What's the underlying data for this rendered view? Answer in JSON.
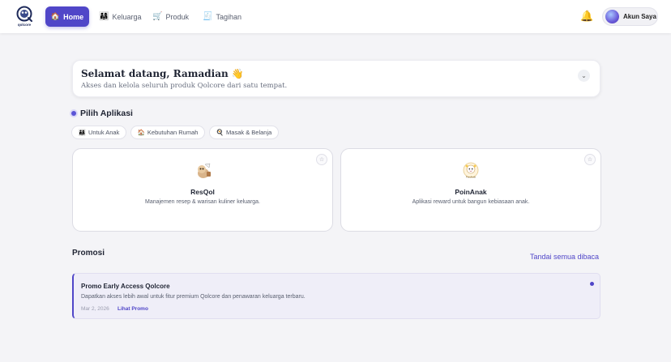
{
  "nav": {
    "logo_text": "qolcore",
    "items": [
      {
        "label": "Home",
        "icon": "house-icon",
        "glyph": "🏠",
        "active": true
      },
      {
        "label": "Keluarga",
        "icon": "family-icon",
        "glyph": "👨‍👩‍👧"
      },
      {
        "label": "Produk",
        "icon": "cart-icon",
        "glyph": "🛒"
      },
      {
        "label": "Tagihan",
        "icon": "receipt-icon",
        "glyph": "🧾"
      }
    ],
    "bell_glyph": "🔔",
    "account_label": "Akun Saya"
  },
  "welcome": {
    "title": "Selamat datang, Ramadian 👋",
    "subtitle": "Akses dan kelola seluruh produk Qolcore dari satu tempat."
  },
  "apps_section": {
    "title": "Pilih Aplikasi",
    "chips": [
      {
        "glyph": "👨‍👩‍👧",
        "label": "Untuk Anak"
      },
      {
        "glyph": "🏠",
        "label": "Kebutuhan Rumah"
      },
      {
        "glyph": "🍳",
        "label": "Masak & Belanja"
      }
    ],
    "apps": [
      {
        "name": "ResQol",
        "description": "Manajemen resep & warisan kuliner keluarga."
      },
      {
        "name": "PoinAnak",
        "description": "Aplikasi reward untuk bangun kebiasaan anak.",
        "icon_text": "PoinAnak"
      }
    ],
    "star_glyph": "☆"
  },
  "promo": {
    "title": "Promosi",
    "mark_all_read": "Tandai semua dibaca",
    "items": [
      {
        "title": "Promo Early Access Qolcore",
        "description": "Dapatkan akses lebih awal untuk fitur premium Qolcore dan penawaran keluarga terbaru.",
        "date": "Mar 2, 2026",
        "link": "Lihat Promo"
      }
    ]
  },
  "colors": {
    "accent": "#5046c8",
    "background": "#f4f4f7"
  }
}
